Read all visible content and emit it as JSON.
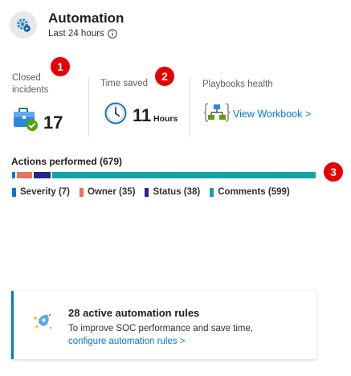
{
  "header": {
    "title": "Automation",
    "subtitle": "Last 24 hours",
    "icon": "automation-gear-icon"
  },
  "badges": [
    "1",
    "2",
    "3"
  ],
  "metrics": {
    "closed": {
      "label_line1": "Closed",
      "label_line2": "incidents",
      "value": "17",
      "icon": "briefcase-check-icon"
    },
    "time": {
      "label": "Time saved",
      "value": "11",
      "unit": "Hours",
      "icon": "clock-icon"
    },
    "playbooks": {
      "label": "Playbooks health",
      "link": "View Workbook >",
      "icon": "workbook-icon"
    }
  },
  "actions": {
    "title": "Actions performed (679)",
    "total": 679,
    "items": [
      {
        "label": "Severity (7)",
        "count": 7,
        "color": "#0078d4"
      },
      {
        "label": "Owner (35)",
        "count": 35,
        "color": "#e8735a"
      },
      {
        "label": "Status (38)",
        "count": 38,
        "color": "#1f2a8a"
      },
      {
        "label": "Comments (599)",
        "count": 599,
        "color": "#13a3a7"
      }
    ]
  },
  "card": {
    "title": "28 active automation rules",
    "text": "To improve SOC performance and save time,",
    "link": "configure automation rules >",
    "accent": "#0078d4",
    "icon": "rocket-rules-icon"
  }
}
